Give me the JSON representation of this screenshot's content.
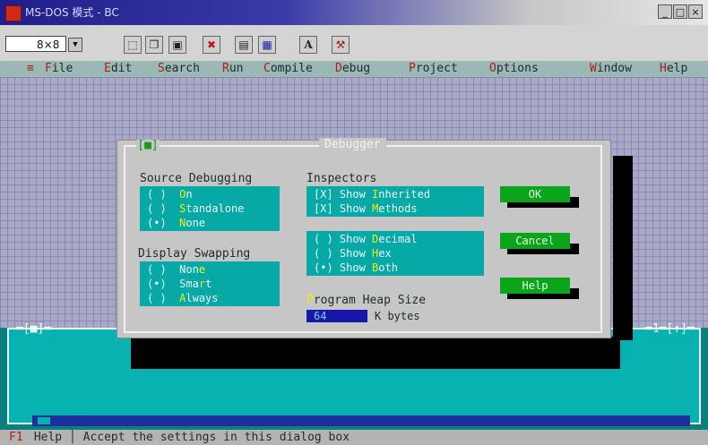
{
  "window": {
    "title": "MS-DOS 模式 - BC",
    "minimize": "_",
    "maximize": "□",
    "close": "×"
  },
  "toolbar": {
    "font_size": "8×8",
    "buttons": [
      "font-size-dropdown-icon",
      "mark-icon",
      "copy-icon",
      "paste-icon",
      "full-screen-icon",
      "properties-icon",
      "background-icon",
      "font-icon",
      "extra-icon"
    ]
  },
  "menu": {
    "system": "≡",
    "items": [
      {
        "hot": "F",
        "rest": "ile"
      },
      {
        "hot": "E",
        "rest": "dit"
      },
      {
        "hot": "S",
        "rest": "earch"
      },
      {
        "hot": "R",
        "rest": "un"
      },
      {
        "hot": "C",
        "rest": "ompile"
      },
      {
        "hot": "D",
        "rest": "ebug"
      },
      {
        "hot": "P",
        "rest": "roject"
      },
      {
        "hot": "O",
        "rest": "ptions"
      },
      {
        "hot": "W",
        "rest": "indow"
      },
      {
        "hot": "H",
        "rest": "elp"
      }
    ]
  },
  "dialog": {
    "close": "[■]",
    "title": "Debugger",
    "source_debugging": {
      "label": "Source Debugging",
      "options": [
        {
          "mark": "( )",
          "hot": "O",
          "rest": "n",
          "selected": false
        },
        {
          "mark": "( )",
          "hot": "S",
          "rest": "tandalone",
          "selected": false
        },
        {
          "mark": "(•)",
          "hot": "N",
          "rest": "one",
          "selected": true
        }
      ]
    },
    "display_swapping": {
      "label": "Display Swapping",
      "options": [
        {
          "mark": "( )",
          "pre": "Non",
          "hot": "e",
          "rest": "",
          "selected": false
        },
        {
          "mark": "(•)",
          "pre": "Sma",
          "hot": "r",
          "rest": "t",
          "selected": true
        },
        {
          "mark": "( )",
          "pre": "",
          "hot": "A",
          "rest": "lways",
          "selected": false
        }
      ]
    },
    "inspectors": {
      "label": "Inspectors",
      "checkboxes": [
        {
          "mark": "[X]",
          "pre": "Show ",
          "hot": "I",
          "rest": "nherited",
          "checked": true
        },
        {
          "mark": "[X]",
          "pre": "Show ",
          "hot": "M",
          "rest": "ethods",
          "checked": true
        }
      ],
      "radios": [
        {
          "mark": "( )",
          "pre": "Show ",
          "hot": "D",
          "rest": "ecimal",
          "selected": false
        },
        {
          "mark": "( )",
          "pre": "Show ",
          "hot": "H",
          "rest": "ex",
          "selected": false
        },
        {
          "mark": "(•)",
          "pre": "Show ",
          "hot": "B",
          "rest": "oth",
          "selected": true
        }
      ]
    },
    "heap": {
      "hot": "P",
      "label": "rogram Heap Size",
      "value": "64",
      "unit": "K bytes"
    },
    "buttons": {
      "ok": "OK",
      "cancel": "Cancel",
      "help": "Help"
    }
  },
  "edit_window": {
    "left_frame": "═[■]═",
    "right_frame": "═1═[↑]═"
  },
  "status": {
    "key": "F1",
    "text": " Help │ Accept the settings in this dialog box"
  }
}
